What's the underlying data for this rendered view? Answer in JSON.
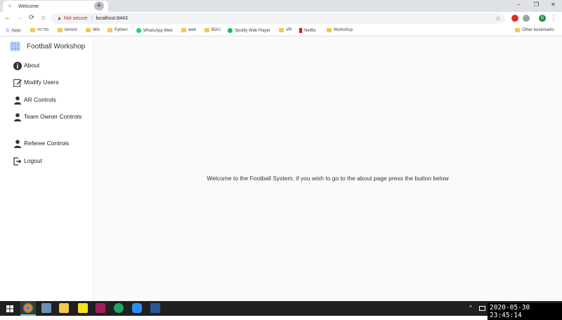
{
  "browser": {
    "tab_title": "Welcome",
    "tab_close": "×",
    "new_tab": "+",
    "window_controls": [
      "–",
      "❐",
      "✕"
    ],
    "nav": {
      "back": "←",
      "forward": "→",
      "reload": "⟳",
      "home": "⌂"
    },
    "omnibox": {
      "security": "Not secure",
      "separator": "|",
      "url": "localhost:8443",
      "star": "☆"
    },
    "profile_initial": "G",
    "bookmarks": [
      "Apps",
      "סדרות",
      "torrent",
      "Win",
      "Python",
      "WhatsApp Web",
      "web",
      "BGU",
      "Spotify Web Player",
      "VR",
      "Netflix",
      "Workshop"
    ],
    "other_bookmarks": "Other bookmarks"
  },
  "app": {
    "brand": "Football Workshop",
    "nav": [
      {
        "label": "About",
        "icon": "info-icon"
      },
      {
        "label": "Modify Users",
        "icon": "edit-icon"
      },
      {
        "label": "AR Controls",
        "icon": "user-icon"
      },
      {
        "label": "Team Owner Controls",
        "icon": "user-icon"
      },
      {
        "label": "Referee Controls",
        "icon": "user-icon"
      },
      {
        "label": "Logout",
        "icon": "logout-icon"
      }
    ],
    "welcome_text": "Welcome to the Football System. if you wish to go to the about page press the button below"
  },
  "taskbar": {
    "tray_arrow": "^",
    "datetime": "2020-05-30  23:45:14"
  }
}
